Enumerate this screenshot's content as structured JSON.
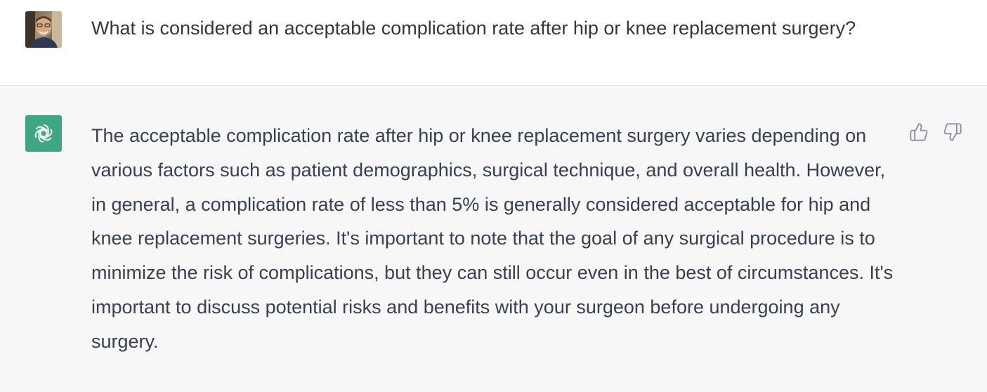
{
  "user_turn": {
    "avatar_icon": "user-avatar-photo",
    "message": "What is considered an acceptable complication rate after hip or knee replacement surgery?"
  },
  "assistant_turn": {
    "avatar_icon": "openai-logo-icon",
    "avatar_color": "#3da682",
    "message": "The acceptable complication rate after hip or knee replacement surgery varies depending on various factors such as patient demographics, surgical technique, and overall health. However, in general, a complication rate of less than 5% is generally considered acceptable for hip and knee replacement surgeries. It's important to note that the goal of any surgical procedure is to minimize the risk of complications, but they can still occur even in the best of circumstances. It's important to discuss potential risks and benefits with your surgeon before undergoing any surgery.",
    "feedback": {
      "thumbs_up_icon": "thumbs-up-icon",
      "thumbs_down_icon": "thumbs-down-icon"
    }
  },
  "colors": {
    "user_bg": "#ffffff",
    "assistant_bg": "#f7f7f8",
    "text": "#343541",
    "icon_gray": "#8e8ea0"
  }
}
